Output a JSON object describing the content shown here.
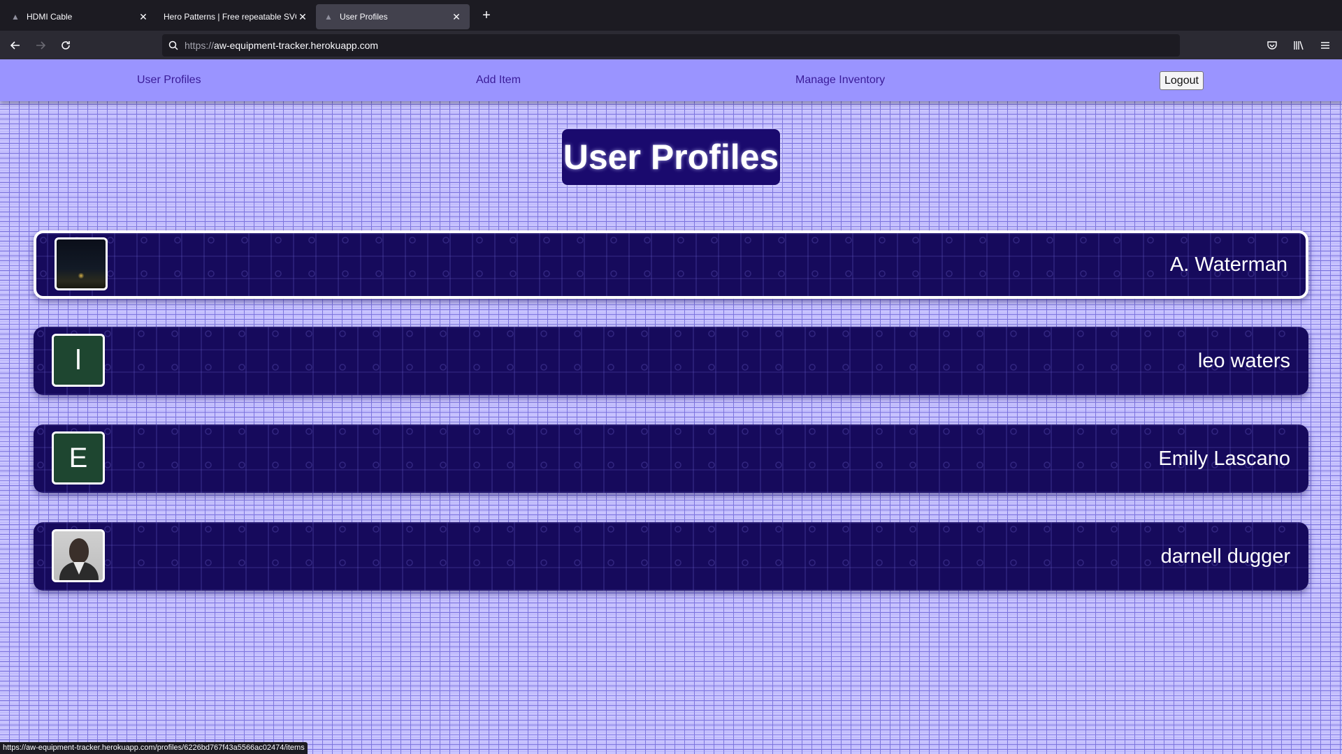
{
  "browser": {
    "tabs": [
      {
        "title": "HDMI Cable",
        "icon": "site-icon"
      },
      {
        "title": "Hero Patterns | Free repeatable SVG",
        "icon": "site-icon"
      },
      {
        "title": "User Profiles",
        "icon": "site-icon",
        "active": true
      }
    ],
    "url_scheme": "https://",
    "url_host": "aw-equipment-tracker.herokuapp.com",
    "status_url": "https://aw-equipment-tracker.herokuapp.com/profiles/6226bd767f43a5566ac02474/items"
  },
  "site_nav": {
    "user_profiles": "User Profiles",
    "add_item": "Add Item",
    "manage_inventory": "Manage Inventory",
    "logout": "Logout"
  },
  "page_title": "User Profiles",
  "profiles": [
    {
      "name": "A. Waterman",
      "avatar_type": "photo-night-sky",
      "selected": true
    },
    {
      "name": "leo waters",
      "avatar_type": "letter",
      "avatar_letter": "l"
    },
    {
      "name": "Emily Lascano",
      "avatar_type": "letter",
      "avatar_letter": "E"
    },
    {
      "name": "darnell dugger",
      "avatar_type": "photo-person"
    }
  ],
  "colors": {
    "nav_bg": "#9a94ff",
    "nav_link": "#3a1c98",
    "card_bg": "#160a5c",
    "heading_bg": "#1a0a6e",
    "letter_avatar_bg": "#1e4630",
    "page_pattern_bg": "#c9c4ff"
  }
}
